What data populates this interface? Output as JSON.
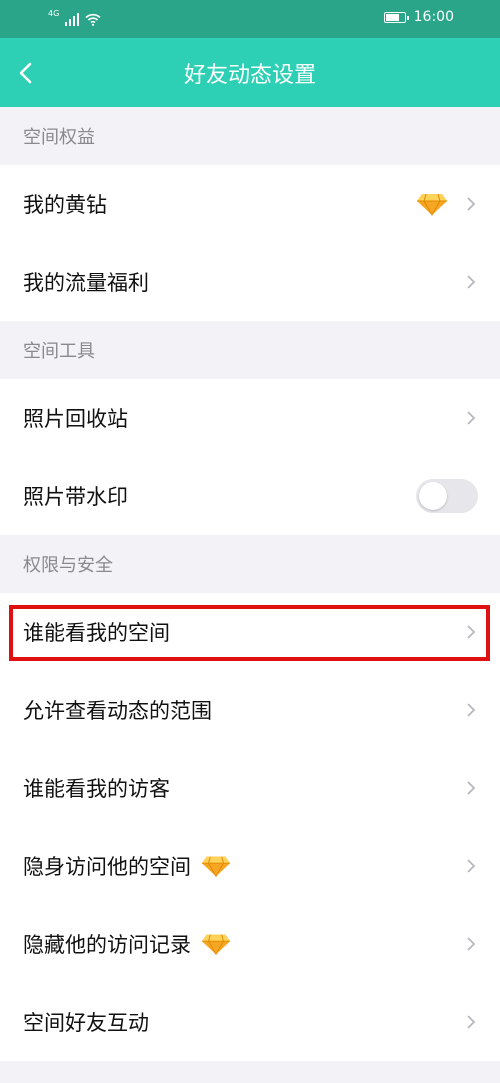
{
  "status_bar": {
    "network": "4G",
    "time": "16:00",
    "battery_level": 0.75
  },
  "header": {
    "title": "好友动态设置",
    "back_icon": "chevron-left-icon"
  },
  "sections": [
    {
      "title": "空间权益",
      "items": [
        {
          "label": "我的黄钻",
          "badge": "diamond-icon"
        },
        {
          "label": "我的流量福利"
        }
      ]
    },
    {
      "title": "空间工具",
      "items": [
        {
          "label": "照片回收站"
        },
        {
          "label": "照片带水印",
          "toggle": false
        }
      ]
    },
    {
      "title": "权限与安全",
      "items": [
        {
          "label": "谁能看我的空间",
          "highlighted": true
        },
        {
          "label": "允许查看动态的范围"
        },
        {
          "label": "谁能看我的访客"
        },
        {
          "label": "隐身访问他的空间",
          "badge": "diamond-icon"
        },
        {
          "label": "隐藏他的访问记录",
          "badge": "diamond-icon"
        },
        {
          "label": "空间好友互动"
        }
      ]
    }
  ],
  "colors": {
    "status_bar": "#2ba58a",
    "nav_bar": "#2dd0b4",
    "highlight": "#e01010",
    "diamond": "#f5a623"
  }
}
